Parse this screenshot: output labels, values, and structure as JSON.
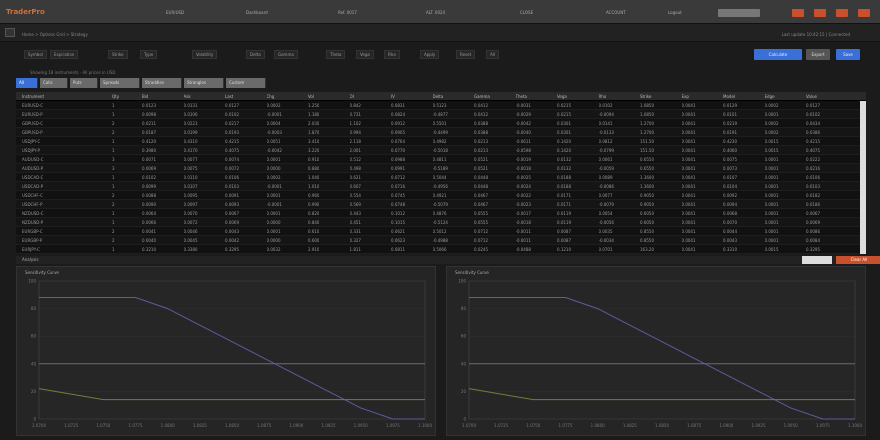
{
  "app": {
    "logo": "TraderPro"
  },
  "topbar": {
    "items": [
      "EUR/USD",
      "Dashboard",
      "Ref. 0017",
      "ALT. 0024",
      "CLOSE",
      "ACCOUNT",
      "Logout"
    ],
    "accent": "#c8502c"
  },
  "breadcrumb": {
    "left": "Home  >  Options Grid  >  Strategy",
    "right": "Last update 10:42:15  |  Connected"
  },
  "toolbar": {
    "tools": [
      "Symbol",
      "Expiration",
      "Strike",
      "Type",
      "Volatility",
      "Delta",
      "Gamma",
      "Theta",
      "Vega",
      "Rho",
      "Apply",
      "Reset",
      "All"
    ],
    "primary_label": "Calculate",
    "secondary_labels": [
      "Export",
      "Save"
    ]
  },
  "info": {
    "text": "Showing 18 instruments  ·  All prices in USD"
  },
  "tabs": [
    {
      "label": "All",
      "active": true
    },
    {
      "label": "Calls",
      "active": false
    },
    {
      "label": "Puts",
      "active": false
    },
    {
      "label": "Spreads",
      "active": false
    },
    {
      "label": "Straddles",
      "active": false
    },
    {
      "label": "Strangles",
      "active": false
    },
    {
      "label": "Custom",
      "active": false
    }
  ],
  "grid": {
    "columns": [
      "Instrument",
      "Qty",
      "Bid",
      "Ask",
      "Last",
      "Chg",
      "Vol",
      "OI",
      "IV",
      "Delta",
      "Gamma",
      "Theta",
      "Vega",
      "Rho",
      "Strike",
      "Exp",
      "Model",
      "Edge",
      "Value"
    ],
    "rows": [
      [
        "EURUSD-C",
        "1",
        "0.0123",
        "0.0131",
        "0.0127",
        "0.0002",
        "1.250",
        "0.842",
        "0.0831",
        "0.5123",
        "0.0412",
        "-0.0031",
        "0.0215",
        "0.0102",
        "1.0850",
        "0.0041",
        "0.0129",
        "0.0002",
        "0.0127"
      ],
      [
        "EURUSD-P",
        "1",
        "0.0098",
        "0.0106",
        "0.0102",
        "-0.0001",
        "1.180",
        "0.731",
        "0.0824",
        "-0.4877",
        "0.0412",
        "-0.0029",
        "0.0215",
        "-0.0094",
        "1.0850",
        "0.0041",
        "0.0101",
        "0.0001",
        "0.0102"
      ],
      [
        "GBPUSD-C",
        "2",
        "0.0211",
        "0.0223",
        "0.0217",
        "0.0004",
        "2.030",
        "1.102",
        "0.0912",
        "0.5501",
        "0.0388",
        "-0.0042",
        "0.0301",
        "0.0141",
        "1.2700",
        "0.0041",
        "0.0219",
        "0.0002",
        "0.0434"
      ],
      [
        "GBPUSD-P",
        "2",
        "0.0187",
        "0.0199",
        "0.0193",
        "-0.0003",
        "1.870",
        "0.994",
        "0.0905",
        "-0.4499",
        "0.0388",
        "-0.0040",
        "0.0301",
        "-0.0133",
        "1.2700",
        "0.0041",
        "0.0191",
        "0.0002",
        "0.0386"
      ],
      [
        "USDJPY-C",
        "1",
        "0.4120",
        "0.4310",
        "0.4215",
        "0.0051",
        "3.410",
        "2.118",
        "0.0764",
        "0.4982",
        "0.0213",
        "-0.0611",
        "0.1420",
        "0.0812",
        "151.50",
        "0.0041",
        "0.4230",
        "0.0015",
        "0.4215"
      ],
      [
        "USDJPY-P",
        "1",
        "0.3980",
        "0.4170",
        "0.4075",
        "-0.0042",
        "3.220",
        "2.001",
        "0.0770",
        "-0.5018",
        "0.0213",
        "-0.0598",
        "0.1420",
        "-0.0799",
        "151.50",
        "0.0041",
        "0.4060",
        "0.0015",
        "0.4075"
      ],
      [
        "AUDUSD-C",
        "3",
        "0.0071",
        "0.0077",
        "0.0074",
        "0.0001",
        "0.910",
        "0.512",
        "0.0988",
        "0.4811",
        "0.0521",
        "-0.0019",
        "0.0132",
        "0.0061",
        "0.6550",
        "0.0041",
        "0.0075",
        "0.0001",
        "0.0222"
      ],
      [
        "AUDUSD-P",
        "3",
        "0.0069",
        "0.0075",
        "0.0072",
        "0.0000",
        "0.880",
        "0.498",
        "0.0991",
        "-0.5189",
        "0.0521",
        "-0.0018",
        "0.0132",
        "-0.0059",
        "0.6550",
        "0.0041",
        "0.0073",
        "0.0001",
        "0.0216"
      ],
      [
        "USDCAD-C",
        "1",
        "0.0102",
        "0.0110",
        "0.0106",
        "0.0002",
        "1.040",
        "0.621",
        "0.0712",
        "0.5044",
        "0.0448",
        "-0.0025",
        "0.0188",
        "0.0089",
        "1.3600",
        "0.0041",
        "0.0107",
        "0.0001",
        "0.0106"
      ],
      [
        "USDCAD-P",
        "1",
        "0.0099",
        "0.0107",
        "0.0103",
        "-0.0001",
        "1.010",
        "0.607",
        "0.0716",
        "-0.4956",
        "0.0448",
        "-0.0024",
        "0.0188",
        "-0.0086",
        "1.3600",
        "0.0041",
        "0.0104",
        "0.0001",
        "0.0103"
      ],
      [
        "USDCHF-C",
        "2",
        "0.0088",
        "0.0095",
        "0.0091",
        "0.0001",
        "0.960",
        "0.554",
        "0.0745",
        "0.4921",
        "0.0467",
        "-0.0022",
        "0.0171",
        "0.0077",
        "0.9050",
        "0.0041",
        "0.0092",
        "0.0001",
        "0.0182"
      ],
      [
        "USDCHF-P",
        "2",
        "0.0090",
        "0.0097",
        "0.0093",
        "-0.0001",
        "0.990",
        "0.569",
        "0.0748",
        "-0.5079",
        "0.0467",
        "-0.0023",
        "0.0171",
        "-0.0079",
        "0.9050",
        "0.0041",
        "0.0094",
        "0.0001",
        "0.0186"
      ],
      [
        "NZDUSD-C",
        "1",
        "0.0064",
        "0.0070",
        "0.0067",
        "0.0001",
        "0.820",
        "0.443",
        "0.1012",
        "0.4876",
        "0.0555",
        "-0.0017",
        "0.0119",
        "0.0054",
        "0.6050",
        "0.0041",
        "0.0068",
        "0.0001",
        "0.0067"
      ],
      [
        "NZDUSD-P",
        "1",
        "0.0066",
        "0.0072",
        "0.0069",
        "0.0000",
        "0.840",
        "0.451",
        "0.1015",
        "-0.5124",
        "0.0555",
        "-0.0018",
        "0.0119",
        "-0.0056",
        "0.6050",
        "0.0041",
        "0.0070",
        "0.0001",
        "0.0069"
      ],
      [
        "EURGBP-C",
        "2",
        "0.0041",
        "0.0046",
        "0.0043",
        "0.0001",
        "0.610",
        "0.331",
        "0.0621",
        "0.5012",
        "0.0712",
        "-0.0011",
        "0.0087",
        "0.0035",
        "0.8550",
        "0.0041",
        "0.0044",
        "0.0001",
        "0.0086"
      ],
      [
        "EURGBP-P",
        "2",
        "0.0040",
        "0.0045",
        "0.0042",
        "0.0000",
        "0.600",
        "0.327",
        "0.0623",
        "-0.4988",
        "0.0712",
        "-0.0011",
        "0.0087",
        "-0.0034",
        "0.8550",
        "0.0041",
        "0.0043",
        "0.0001",
        "0.0084"
      ],
      [
        "EURJPY-C",
        "1",
        "0.3210",
        "0.3380",
        "0.3295",
        "0.0032",
        "2.910",
        "1.811",
        "0.0811",
        "0.5066",
        "0.0245",
        "-0.0488",
        "0.1210",
        "0.0701",
        "163.20",
        "0.0041",
        "0.3310",
        "0.0015",
        "0.3295"
      ]
    ]
  },
  "section": {
    "title": "Analysis",
    "action_label": "Clear All"
  },
  "charts": [
    {
      "title": "Sensitivity Curve",
      "color_line1": "#5c5c9e",
      "color_line2": "#7a7a3a",
      "color_ref": "#6a6a7a"
    },
    {
      "title": "Sensitivity Curve",
      "color_line1": "#5c5c9e",
      "color_line2": "#7a7a3a",
      "color_ref": "#6a6a7a"
    }
  ],
  "chart_data": [
    {
      "type": "line",
      "title": "Sensitivity Curve",
      "x": [
        "1.0700",
        "1.0725",
        "1.0750",
        "1.0775",
        "1.0800",
        "1.0825",
        "1.0850",
        "1.0875",
        "1.0900",
        "1.0925",
        "1.0950",
        "1.0975",
        "1.1000"
      ],
      "ylim": [
        0,
        100
      ],
      "series": [
        {
          "name": "",
          "values": [
            88,
            88,
            88,
            88,
            80,
            68,
            56,
            44,
            32,
            20,
            8,
            0,
            0
          ]
        },
        {
          "name": "",
          "values": [
            22,
            18,
            14,
            14,
            14,
            14,
            14,
            14,
            14,
            14,
            14,
            14,
            14
          ]
        },
        {
          "name": "",
          "values": [
            40,
            40,
            40,
            40,
            40,
            40,
            40,
            40,
            40,
            40,
            40,
            40,
            40
          ]
        }
      ]
    },
    {
      "type": "line",
      "title": "Sensitivity Curve",
      "x": [
        "1.0700",
        "1.0725",
        "1.0750",
        "1.0775",
        "1.0800",
        "1.0825",
        "1.0850",
        "1.0875",
        "1.0900",
        "1.0925",
        "1.0950",
        "1.0975",
        "1.1000"
      ],
      "ylim": [
        0,
        100
      ],
      "series": [
        {
          "name": "",
          "values": [
            88,
            88,
            88,
            88,
            80,
            68,
            56,
            44,
            32,
            20,
            8,
            0,
            0
          ]
        },
        {
          "name": "",
          "values": [
            22,
            18,
            14,
            14,
            14,
            14,
            14,
            14,
            14,
            14,
            14,
            14,
            14
          ]
        },
        {
          "name": "",
          "values": [
            40,
            40,
            40,
            40,
            40,
            40,
            40,
            40,
            40,
            40,
            40,
            40,
            40
          ]
        }
      ]
    }
  ]
}
